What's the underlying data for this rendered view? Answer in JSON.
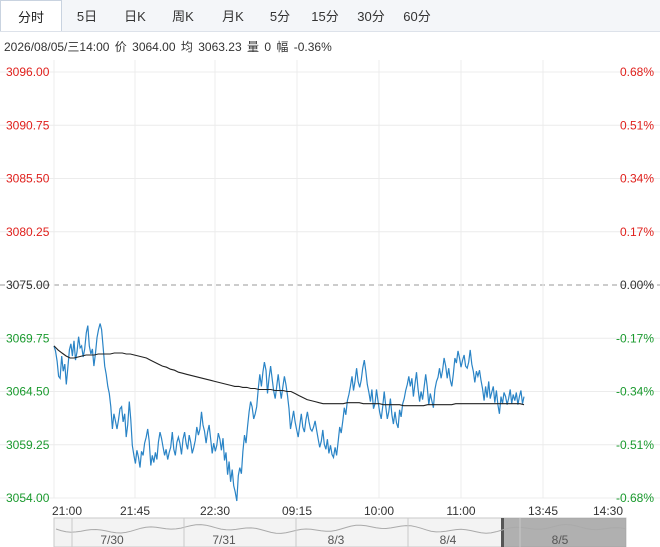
{
  "tabs": [
    "分时",
    "5日",
    "日K",
    "周K",
    "月K",
    "5分",
    "15分",
    "30分",
    "60分"
  ],
  "active_tab": 0,
  "info": {
    "datetime": "2026/08/05/三14:00",
    "price_label": "价",
    "price": "3064.00",
    "avg_label": "均",
    "avg": "3063.23",
    "volume_label": "量",
    "volume": "0",
    "change_label": "幅",
    "change": "-0.36%"
  },
  "colors": {
    "up": "#e0201c",
    "down": "#1a9a2e",
    "price_line": "#2a84c6",
    "avg_line": "#222222",
    "grid": "#ececec"
  },
  "chart_data": {
    "type": "line",
    "y_ticks": [
      "3096.00",
      "3090.75",
      "3085.50",
      "3080.25",
      "3075.00",
      "3069.75",
      "3064.50",
      "3059.25",
      "3054.00"
    ],
    "y_right_ticks": [
      "0.68%",
      "0.51%",
      "0.34%",
      "0.17%",
      "0.00%",
      "-0.17%",
      "-0.34%",
      "-0.51%",
      "-0.68%"
    ],
    "ylim": [
      3054.0,
      3096.0
    ],
    "reference": 3075.0,
    "x_ticks": [
      "21:00",
      "21:45",
      "22:30",
      "09:15",
      "10:00",
      "11:00",
      "13:45",
      "14:30"
    ],
    "navigator_labels": [
      "7/30",
      "7/31",
      "8/3",
      "8/4",
      "8/5"
    ],
    "series": [
      {
        "values": [
          3069.0,
          3068.5,
          3067.5,
          3066.0,
          3065.8,
          3068.0,
          3066.5,
          3067.2,
          3065.2,
          3066.8,
          3068.6,
          3069.2,
          3068.0,
          3069.5,
          3067.6,
          3068.4,
          3069.9,
          3068.8,
          3069.0,
          3067.9,
          3068.7,
          3070.3,
          3071.0,
          3069.0,
          3068.2,
          3068.7,
          3067.0,
          3068.3,
          3069.8,
          3070.6,
          3071.2,
          3070.6,
          3068.8,
          3067.0,
          3066.2,
          3065.0,
          3064.3,
          3063.0,
          3060.8,
          3062.3,
          3061.6,
          3060.8,
          3061.7,
          3062.8,
          3063.0,
          3061.5,
          3062.3,
          3060.0,
          3061.2,
          3063.5,
          3061.7,
          3059.2,
          3058.2,
          3057.4,
          3058.7,
          3058.0,
          3057.0,
          3058.6,
          3058.2,
          3059.4,
          3060.0,
          3060.8,
          3059.6,
          3057.2,
          3058.2,
          3057.5,
          3058.5,
          3057.8,
          3059.5,
          3060.5,
          3059.9,
          3059.0,
          3058.2,
          3058.8,
          3057.8,
          3058.5,
          3059.0,
          3060.5,
          3058.8,
          3058.2,
          3059.5,
          3060.0,
          3059.4,
          3058.3,
          3059.8,
          3060.5,
          3059.4,
          3058.8,
          3060.2,
          3059.5,
          3058.4,
          3059.0,
          3059.7,
          3061.0,
          3060.2,
          3060.8,
          3062.5,
          3061.2,
          3060.6,
          3059.4,
          3060.5,
          3061.2,
          3059.8,
          3058.4,
          3059.4,
          3058.6,
          3059.2,
          3060.4,
          3059.8,
          3058.7,
          3059.9,
          3057.7,
          3058.5,
          3056.3,
          3057.6,
          3055.6,
          3056.8,
          3055.2,
          3054.6,
          3053.7,
          3056.2,
          3057.0,
          3056.4,
          3058.6,
          3060.2,
          3059.4,
          3061.0,
          3062.5,
          3063.5,
          3063.0,
          3061.8,
          3062.3,
          3063.0,
          3064.8,
          3066.2,
          3065.0,
          3066.4,
          3067.4,
          3066.6,
          3064.3,
          3065.8,
          3067.0,
          3065.8,
          3064.6,
          3063.8,
          3065.0,
          3066.2,
          3064.8,
          3063.8,
          3065.0,
          3066.0,
          3065.2,
          3064.1,
          3062.8,
          3060.8,
          3061.7,
          3062.6,
          3061.5,
          3060.7,
          3060.0,
          3061.2,
          3062.3,
          3061.0,
          3060.5,
          3061.7,
          3062.5,
          3061.5,
          3060.8,
          3060.6,
          3061.0,
          3061.6,
          3060.7,
          3059.8,
          3059.0,
          3059.6,
          3060.7,
          3059.3,
          3058.8,
          3059.8,
          3058.4,
          3059.2,
          3058.3,
          3058.0,
          3059.0,
          3058.2,
          3059.6,
          3061.0,
          3060.4,
          3061.6,
          3062.9,
          3062.2,
          3063.6,
          3064.2,
          3065.0,
          3066.0,
          3064.6,
          3065.5,
          3066.8,
          3065.5,
          3064.9,
          3065.6,
          3066.8,
          3067.6,
          3066.5,
          3065.2,
          3064.4,
          3063.5,
          3064.7,
          3062.8,
          3063.3,
          3064.7,
          3063.5,
          3062.5,
          3061.8,
          3063.0,
          3064.5,
          3063.0,
          3061.8,
          3062.5,
          3063.8,
          3062.2,
          3061.3,
          3062.5,
          3061.4,
          3060.9,
          3062.7,
          3062.0,
          3063.3,
          3063.8,
          3064.6,
          3065.2,
          3066.0,
          3065.0,
          3065.8,
          3064.0,
          3065.2,
          3066.4,
          3064.8,
          3063.5,
          3064.5,
          3063.7,
          3065.0,
          3066.2,
          3065.0,
          3063.2,
          3064.3,
          3063.6,
          3062.9,
          3064.7,
          3065.5,
          3065.9,
          3066.8,
          3065.8,
          3066.6,
          3067.8,
          3067.0,
          3065.8,
          3066.8,
          3065.6,
          3065.0,
          3066.2,
          3067.8,
          3067.3,
          3068.5,
          3067.8,
          3066.9,
          3067.6,
          3068.1,
          3067.0,
          3066.8,
          3067.4,
          3068.6,
          3067.2,
          3066.5,
          3065.4,
          3066.5,
          3066.0,
          3066.6,
          3065.6,
          3064.8,
          3063.6,
          3065.0,
          3063.9,
          3065.5,
          3063.8,
          3064.4,
          3065.0,
          3063.4,
          3064.6,
          3063.2,
          3062.3,
          3064.0,
          3063.3,
          3064.4,
          3064.0,
          3063.2,
          3063.8,
          3064.7,
          3063.3,
          3064.2,
          3063.6,
          3064.4,
          3063.2,
          3064.0,
          3064.6,
          3063.3,
          3064.0
        ],
        "avg_values": [
          3069.0,
          3068.6,
          3068.3,
          3068.0,
          3067.8,
          3067.8,
          3067.9,
          3068.0,
          3068.1,
          3068.1,
          3068.1,
          3068.2,
          3068.2,
          3068.2,
          3068.2,
          3068.3,
          3068.3,
          3068.3,
          3068.2,
          3068.2,
          3068.1,
          3068.0,
          3067.9,
          3067.8,
          3067.6,
          3067.4,
          3067.2,
          3067.0,
          3066.9,
          3066.7,
          3066.6,
          3066.4,
          3066.3,
          3066.2,
          3066.1,
          3066.0,
          3065.9,
          3065.8,
          3065.7,
          3065.6,
          3065.5,
          3065.4,
          3065.3,
          3065.2,
          3065.1,
          3065.0,
          3065.0,
          3064.9,
          3064.9,
          3064.8,
          3064.8,
          3064.7,
          3064.7,
          3064.7,
          3064.7,
          3064.6,
          3064.6,
          3064.6,
          3064.5,
          3064.5,
          3064.3,
          3064.1,
          3063.9,
          3063.7,
          3063.6,
          3063.5,
          3063.4,
          3063.3,
          3063.3,
          3063.3,
          3063.3,
          3063.3,
          3063.3,
          3063.4,
          3063.4,
          3063.4,
          3063.4,
          3063.3,
          3063.3,
          3063.3,
          3063.3,
          3063.3,
          3063.2,
          3063.2,
          3063.2,
          3063.2,
          3063.2,
          3063.1,
          3063.1,
          3063.1,
          3063.1,
          3063.1,
          3063.1,
          3063.2,
          3063.2,
          3063.2,
          3063.2,
          3063.2,
          3063.2,
          3063.2,
          3063.3,
          3063.3,
          3063.3,
          3063.3,
          3063.3,
          3063.3,
          3063.3,
          3063.3,
          3063.3,
          3063.3,
          3063.3,
          3063.3,
          3063.3,
          3063.3,
          3063.3,
          3063.3,
          3063.3,
          3063.2
        ]
      }
    ]
  }
}
